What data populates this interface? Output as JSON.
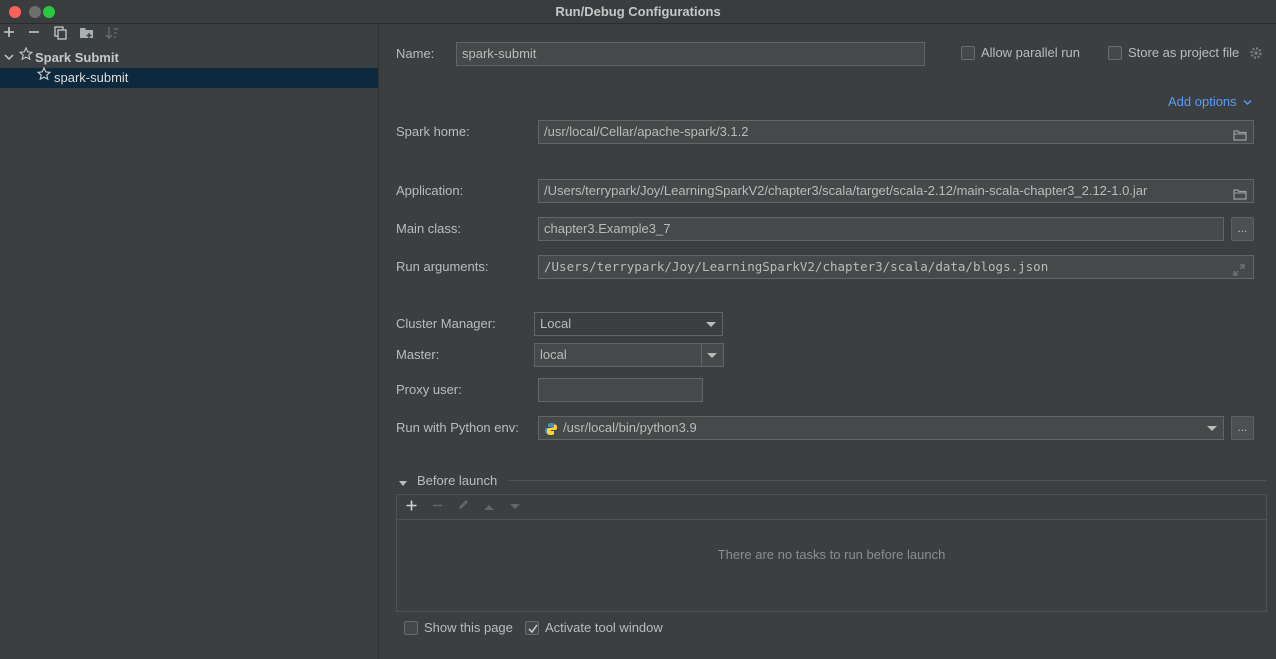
{
  "window": {
    "title": "Run/Debug Configurations"
  },
  "tree": {
    "group_label": "Spark Submit",
    "item_label": "spark-submit"
  },
  "form": {
    "name_label": "Name:",
    "name_value": "spark-submit",
    "allow_parallel_label": "Allow parallel run",
    "store_project_label": "Store as project file",
    "add_options_label": "Add options",
    "spark_home_label": "Spark home:",
    "spark_home_value": "/usr/local/Cellar/apache-spark/3.1.2",
    "application_label": "Application:",
    "application_value": "/Users/terrypark/Joy/LearningSparkV2/chapter3/scala/target/scala-2.12/main-scala-chapter3_2.12-1.0.jar",
    "main_class_label": "Main class:",
    "main_class_value": "chapter3.Example3_7",
    "run_args_label": "Run arguments:",
    "run_args_value": "/Users/terrypark/Joy/LearningSparkV2/chapter3/scala/data/blogs.json",
    "cluster_manager_label": "Cluster Manager:",
    "cluster_manager_value": "Local",
    "master_label": "Master:",
    "master_value": "local",
    "proxy_user_label": "Proxy user:",
    "proxy_user_value": "",
    "python_env_label": "Run with Python env:",
    "python_env_value": "/usr/local/bin/python3.9",
    "browse_label": "..."
  },
  "before_launch": {
    "title": "Before launch",
    "empty_text": "There are no tasks to run before launch"
  },
  "footer": {
    "show_page_label": "Show this page",
    "activate_tool_label": "Activate tool window"
  },
  "colors": {
    "background": "#3c3f41",
    "selection": "#0d293e",
    "link": "#589df6",
    "field_bg": "#45494a"
  },
  "icons": [
    "add-icon",
    "remove-icon",
    "copy-icon",
    "folder-add-icon",
    "sort-icon",
    "chevron-down-icon",
    "star-icon",
    "gear-icon",
    "folder-icon",
    "expand-icon",
    "python-icon",
    "pencil-icon",
    "arrow-up-icon",
    "arrow-down-icon",
    "checkmark-icon"
  ],
  "state": {
    "allow_parallel_checked": false,
    "store_project_checked": false,
    "show_page_checked": false,
    "activate_tool_checked": true
  }
}
